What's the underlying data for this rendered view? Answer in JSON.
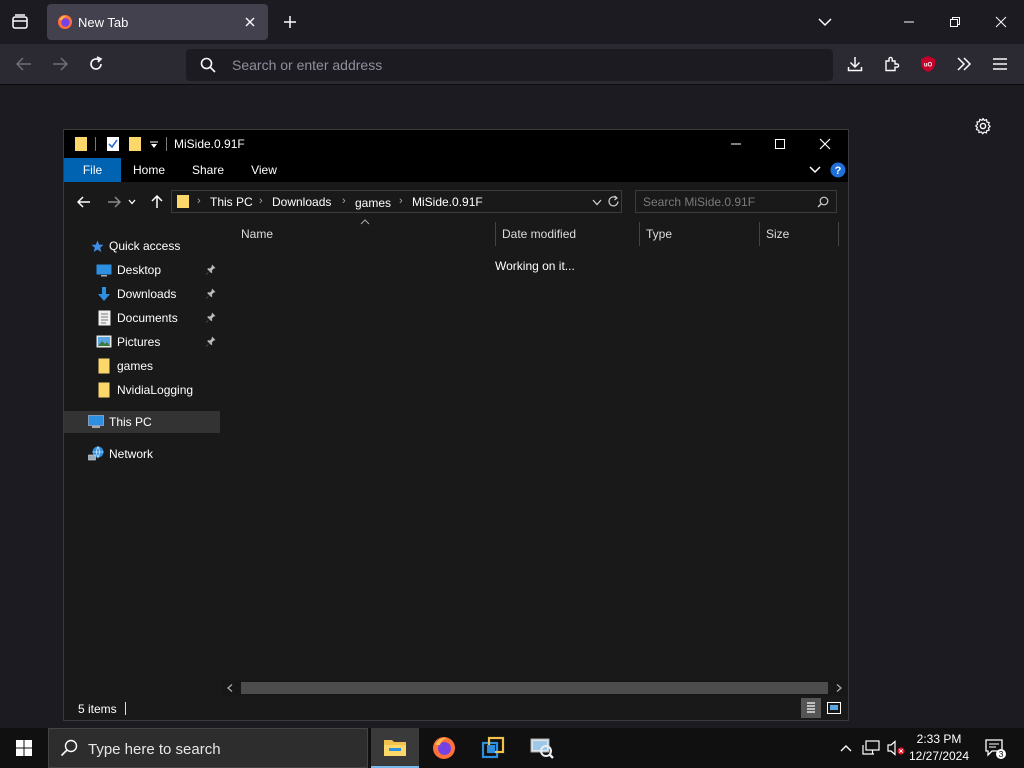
{
  "browser": {
    "tab_title": "New Tab",
    "address_placeholder": "Search or enter address"
  },
  "explorer": {
    "window_title": "MiSide.0.91F",
    "ribbon_tabs": [
      "File",
      "Home",
      "Share",
      "View"
    ],
    "breadcrumb": [
      "This PC",
      "Downloads",
      "games",
      "MiSide.0.91F"
    ],
    "search_placeholder": "Search MiSide.0.91F",
    "nav": {
      "quick_access": "Quick access",
      "desktop": "Desktop",
      "downloads": "Downloads",
      "documents": "Documents",
      "pictures": "Pictures",
      "games": "games",
      "nvidia": "NvidiaLogging",
      "this_pc": "This PC",
      "network": "Network"
    },
    "columns": [
      "Name",
      "Date modified",
      "Type",
      "Size"
    ],
    "loading_text": "Working on it...",
    "status_items": "5 items"
  },
  "taskbar": {
    "search_placeholder": "Type here to search",
    "time": "2:33 PM",
    "date": "12/27/2024",
    "notification_count": "3"
  },
  "colors": {
    "accent_blue": "#0063b1",
    "firefox_bg": "#1c1b22",
    "explorer_bg": "#191919"
  }
}
